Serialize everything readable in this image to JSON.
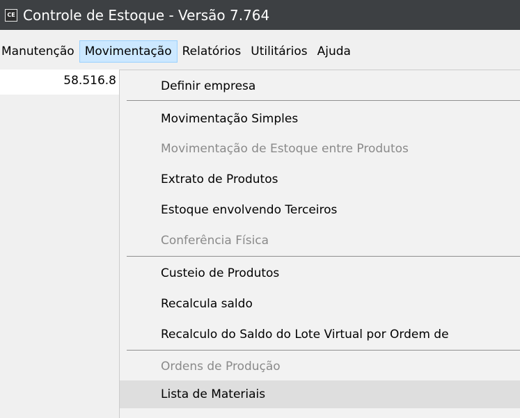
{
  "window": {
    "icon_label": "CE",
    "title": "Controle de Estoque - Versão 7.764"
  },
  "menubar": {
    "items": [
      {
        "label": "Manutenção"
      },
      {
        "label": "Movimentação"
      },
      {
        "label": "Relatórios"
      },
      {
        "label": "Utilitários"
      },
      {
        "label": "Ajuda"
      }
    ]
  },
  "left_panel": {
    "value": "58.516.8"
  },
  "dropdown": {
    "items": [
      {
        "label": "Definir empresa",
        "enabled": true
      },
      {
        "label": "Movimentação Simples",
        "enabled": true
      },
      {
        "label": "Movimentação de Estoque entre Produtos",
        "enabled": false
      },
      {
        "label": "Extrato de Produtos",
        "enabled": true
      },
      {
        "label": "Estoque envolvendo Terceiros",
        "enabled": true
      },
      {
        "label": "Conferência Física",
        "enabled": false
      },
      {
        "label": "Custeio de Produtos",
        "enabled": true
      },
      {
        "label": "Recalcula saldo",
        "enabled": true
      },
      {
        "label": "Recalculo do Saldo do Lote Virtual por Ordem de",
        "enabled": true
      },
      {
        "label": "Ordens de Produção",
        "enabled": false
      },
      {
        "label": "Lista de Materiais",
        "enabled": true,
        "highlighted": true
      }
    ]
  }
}
